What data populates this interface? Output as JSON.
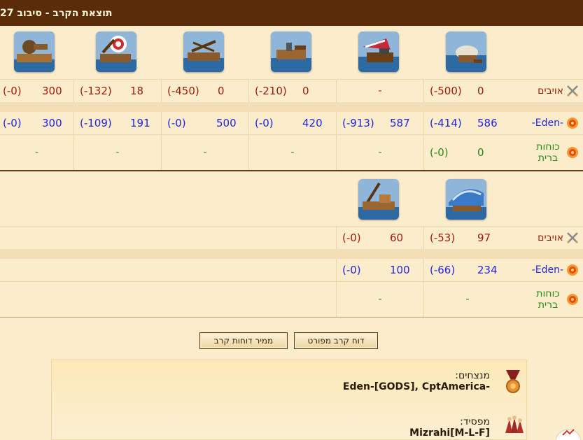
{
  "title": "תוצאת הקרב - סיבוב 27",
  "labels": {
    "enemies": "אויבים",
    "player": "-Eden-",
    "allies": "כוחות ברית"
  },
  "colors": {
    "enemy": "#a11b0d",
    "player": "#2424d8",
    "ally": "#2a8a12",
    "header": "#5a2c0a"
  },
  "round1": {
    "units": [
      {
        "icon": "ram-ship-icon",
        "enemy": {
          "count": "0",
          "loss": "(-500)"
        },
        "player": {
          "count": "586",
          "loss": "(-414)"
        },
        "ally": {
          "count": "0",
          "loss": "(-0)"
        }
      },
      {
        "icon": "flame-ship-icon",
        "enemy": {
          "dash": "-"
        },
        "player": {
          "count": "587",
          "loss": "(-913)"
        },
        "ally": {
          "dash": "-"
        }
      },
      {
        "icon": "steam-ram-icon",
        "enemy": {
          "count": "0",
          "loss": "(-210)"
        },
        "player": {
          "count": "420",
          "loss": "(-0)"
        },
        "ally": {
          "dash": "-"
        }
      },
      {
        "icon": "ballista-ship-icon",
        "enemy": {
          "count": "0",
          "loss": "(-450)"
        },
        "player": {
          "count": "500",
          "loss": "(-0)"
        },
        "ally": {
          "dash": "-"
        }
      },
      {
        "icon": "catapult-ship-icon",
        "enemy": {
          "count": "18",
          "loss": "(-132)"
        },
        "player": {
          "count": "191",
          "loss": "(-109)"
        },
        "ally": {
          "dash": "-"
        }
      },
      {
        "icon": "mortar-ship-icon",
        "enemy": {
          "count": "300",
          "loss": "(-0)"
        },
        "player": {
          "count": "300",
          "loss": "(-0)"
        },
        "ally": {
          "dash": "-"
        }
      }
    ]
  },
  "round2": {
    "units": [
      {
        "icon": "paddle-speedboat-icon",
        "enemy": {
          "count": "97",
          "loss": "(-53)"
        },
        "player": {
          "count": "234",
          "loss": "(-66)"
        },
        "ally": {
          "dash": "-"
        }
      },
      {
        "icon": "tender-ship-icon",
        "enemy": {
          "count": "60",
          "loss": "(-0)"
        },
        "player": {
          "count": "100",
          "loss": "(-0)"
        },
        "ally": {
          "dash": "-"
        }
      }
    ]
  },
  "buttons": {
    "detailed": "דוח קרב מפורט",
    "converter": "ממיר דוחות קרב"
  },
  "result": {
    "winners_label": "מנצחים:",
    "winners": "Eden-[GODS], CptAmerica-",
    "loser_label": "מפסיד:",
    "loser": "Mizrahi[M-L-F]"
  }
}
